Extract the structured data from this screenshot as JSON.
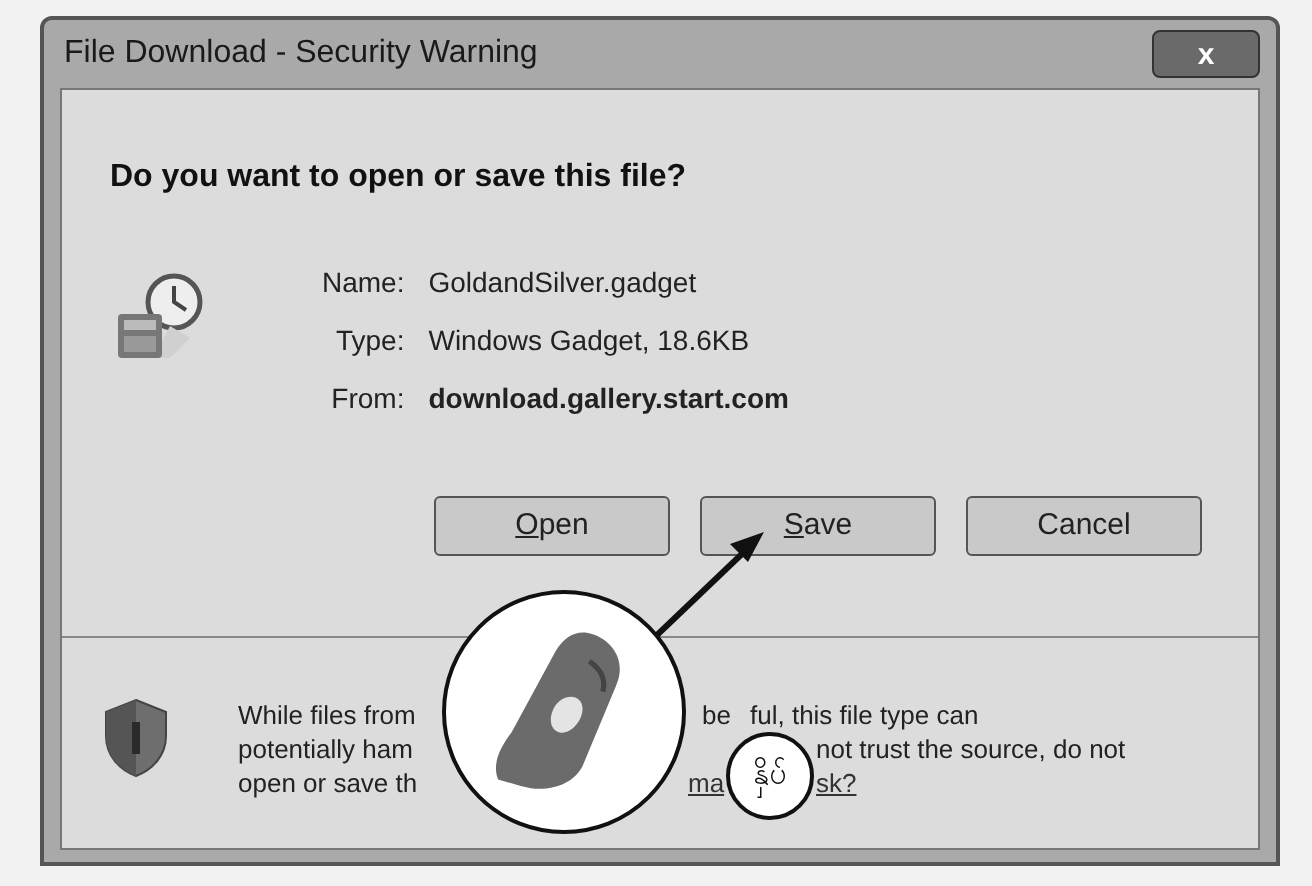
{
  "window": {
    "title": "File Download - Security Warning",
    "close": "x"
  },
  "heading": "Do you want to open or save this file?",
  "details": [
    {
      "label": "Name:",
      "value": "GoldandSilver.gadget",
      "bold": false
    },
    {
      "label": "Type:",
      "value": "Windows Gadget, 18.6KB",
      "bold": false
    },
    {
      "label": "From:",
      "value": "download.gallery.start.com",
      "bold": true
    }
  ],
  "buttons": [
    {
      "label": "Open",
      "underline_first": true
    },
    {
      "label": "Save",
      "underline_first": true
    },
    {
      "label": "Cancel",
      "underline_first": false
    }
  ],
  "warning": [
    [
      {
        "kind": "text",
        "text": "While files from"
      },
      {
        "kind": "text",
        "text": "be"
      },
      {
        "kind": "text",
        "text": "ful, this file type can"
      }
    ],
    [
      {
        "kind": "text",
        "text": "potentially ham"
      },
      {
        "kind": "text",
        "text": "not trust the source, do not"
      }
    ],
    [
      {
        "kind": "text",
        "text": "open or save th"
      },
      {
        "kind": "link",
        "text": "ma"
      },
      {
        "kind": "link",
        "text": "sk?"
      }
    ]
  ],
  "callout": {
    "label": "နှိပ်"
  }
}
